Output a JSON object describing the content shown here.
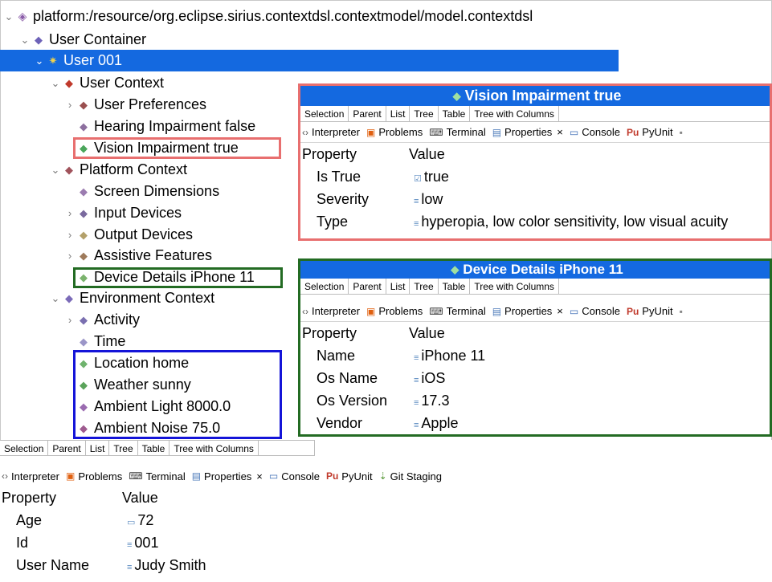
{
  "tree": {
    "root": "platform:/resource/org.eclipse.sirius.contextdsl.contextmodel/model.contextdsl",
    "user_container": "User Container",
    "user": "User 001",
    "user_context": "User Context",
    "user_preferences": "User Preferences",
    "hearing": "Hearing Impairment false",
    "vision": "Vision Impairment true",
    "platform_context": "Platform Context",
    "screen": "Screen Dimensions",
    "input": "Input Devices",
    "output": "Output Devices",
    "assistive": "Assistive Features",
    "device": "Device Details iPhone 11",
    "environment_context": "Environment Context",
    "activity": "Activity",
    "time": "Time",
    "location": "Location home",
    "weather": "Weather sunny",
    "light": "Ambient Light 8000.0",
    "noise": "Ambient Noise 75.0"
  },
  "selection_tabs": [
    "Selection",
    "Parent",
    "List",
    "Tree",
    "Table",
    "Tree with Columns"
  ],
  "view_tabs": {
    "interpreter": "Interpreter",
    "problems": "Problems",
    "terminal": "Terminal",
    "properties": "Properties",
    "console": "Console",
    "pyunit": "PyUnit",
    "git": "Git Staging",
    "close": "×"
  },
  "icons": {
    "model": "model-file-icon",
    "element": "diamond-icon",
    "value": "value-icon",
    "boolean": "boolean-icon",
    "number": "number-icon"
  },
  "vision_panel": {
    "title": "Vision Impairment true",
    "header_property": "Property",
    "header_value": "Value",
    "rows": [
      {
        "key": "Is True",
        "value": "true"
      },
      {
        "key": "Severity",
        "value": "low"
      },
      {
        "key": "Type",
        "value": "hyperopia, low color sensitivity, low visual acuity"
      }
    ]
  },
  "device_panel": {
    "title": "Device Details iPhone 11",
    "header_property": "Property",
    "header_value": "Value",
    "rows": [
      {
        "key": "Name",
        "value": "iPhone 11"
      },
      {
        "key": "Os Name",
        "value": "iOS"
      },
      {
        "key": "Os Version",
        "value": "17.3"
      },
      {
        "key": "Vendor",
        "value": "Apple"
      }
    ]
  },
  "user_props": {
    "header_property": "Property",
    "header_value": "Value",
    "rows": [
      {
        "key": "Age",
        "value": "72"
      },
      {
        "key": "Id",
        "value": "001"
      },
      {
        "key": "User Name",
        "value": "Judy Smith"
      }
    ]
  },
  "colors": {
    "selection": "#1469e0",
    "highlight_red": "#e86f6f",
    "highlight_green": "#236b23",
    "highlight_blue": "#1414d8"
  }
}
